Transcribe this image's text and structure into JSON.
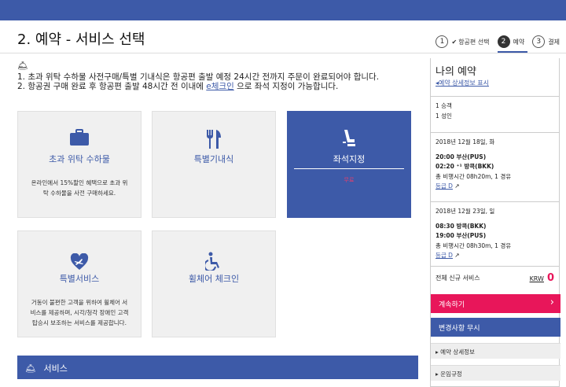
{
  "header": {
    "title": "2. 예약 - 서비스 선택"
  },
  "steps": [
    {
      "num": "1",
      "check": "✔",
      "label": "항공편 선택"
    },
    {
      "num": "2",
      "label": "예약"
    },
    {
      "num": "3",
      "label": "결제"
    }
  ],
  "notice": {
    "bell": "🛎",
    "line1": "1. 초과 위탁 수하물 사전구매/특별 기내식은 항공편 출발 예정 24시간 전까지 주문이 완료되어야 합니다.",
    "line2_a": "2. 항공권 구매 완료 후 항공편 출발 48시간 전 이내에 ",
    "line2_link": "e체크인",
    "line2_b": " 으로 좌석 지정이 가능합니다."
  },
  "cards": {
    "baggage": {
      "title": "초과 위탁 수하물",
      "desc": "온라인에서 15%할인 혜택으로 초과 위탁 수하물을 사전 구매하세요."
    },
    "meal": {
      "title": "특별기내식"
    },
    "seat": {
      "title": "좌석지정",
      "note": "무료"
    },
    "special": {
      "title": "특별서비스",
      "desc": "거동이 불편한 고객을 위하여 휠체어 서비스를 제공하며, 시각/청각 장애인 고객 탑승시 보조하는 서비스를 제공합니다."
    },
    "wheelchair": {
      "title": "휠체어 체크인"
    }
  },
  "service_bar": {
    "icon": "🛎",
    "label": "서비스"
  },
  "sidebar": {
    "title": "나의 예약",
    "detail_link": "◂예약 상세정보 표시",
    "passengers": [
      "1 승객",
      "1 성인"
    ],
    "outbound": {
      "date": "2018년 12월 18일, 화",
      "dep": "20:00 부산(PUS)",
      "arr": "02:20 ⁺¹ 방콕(BKK)",
      "duration": "총 비행시간 08h20m, 1 경유",
      "fare": "등급 D"
    },
    "inbound": {
      "date": "2018년 12월 23일, 일",
      "dep": "08:30 방콕(BKK)",
      "arr": "19:00 부산(PUS)",
      "duration": "총 비행시간 08h30m, 1 경유",
      "fare": "등급 D"
    },
    "total_label": "전체 신규 서비스",
    "currency": "KRW",
    "total_amount": "0",
    "continue": "계속하기",
    "ignore": "변경사항 무시",
    "accordions": [
      "예약 상세정보",
      "운임규정"
    ]
  },
  "colors": {
    "primary": "#3d5aa8",
    "accent": "#e8165a"
  }
}
